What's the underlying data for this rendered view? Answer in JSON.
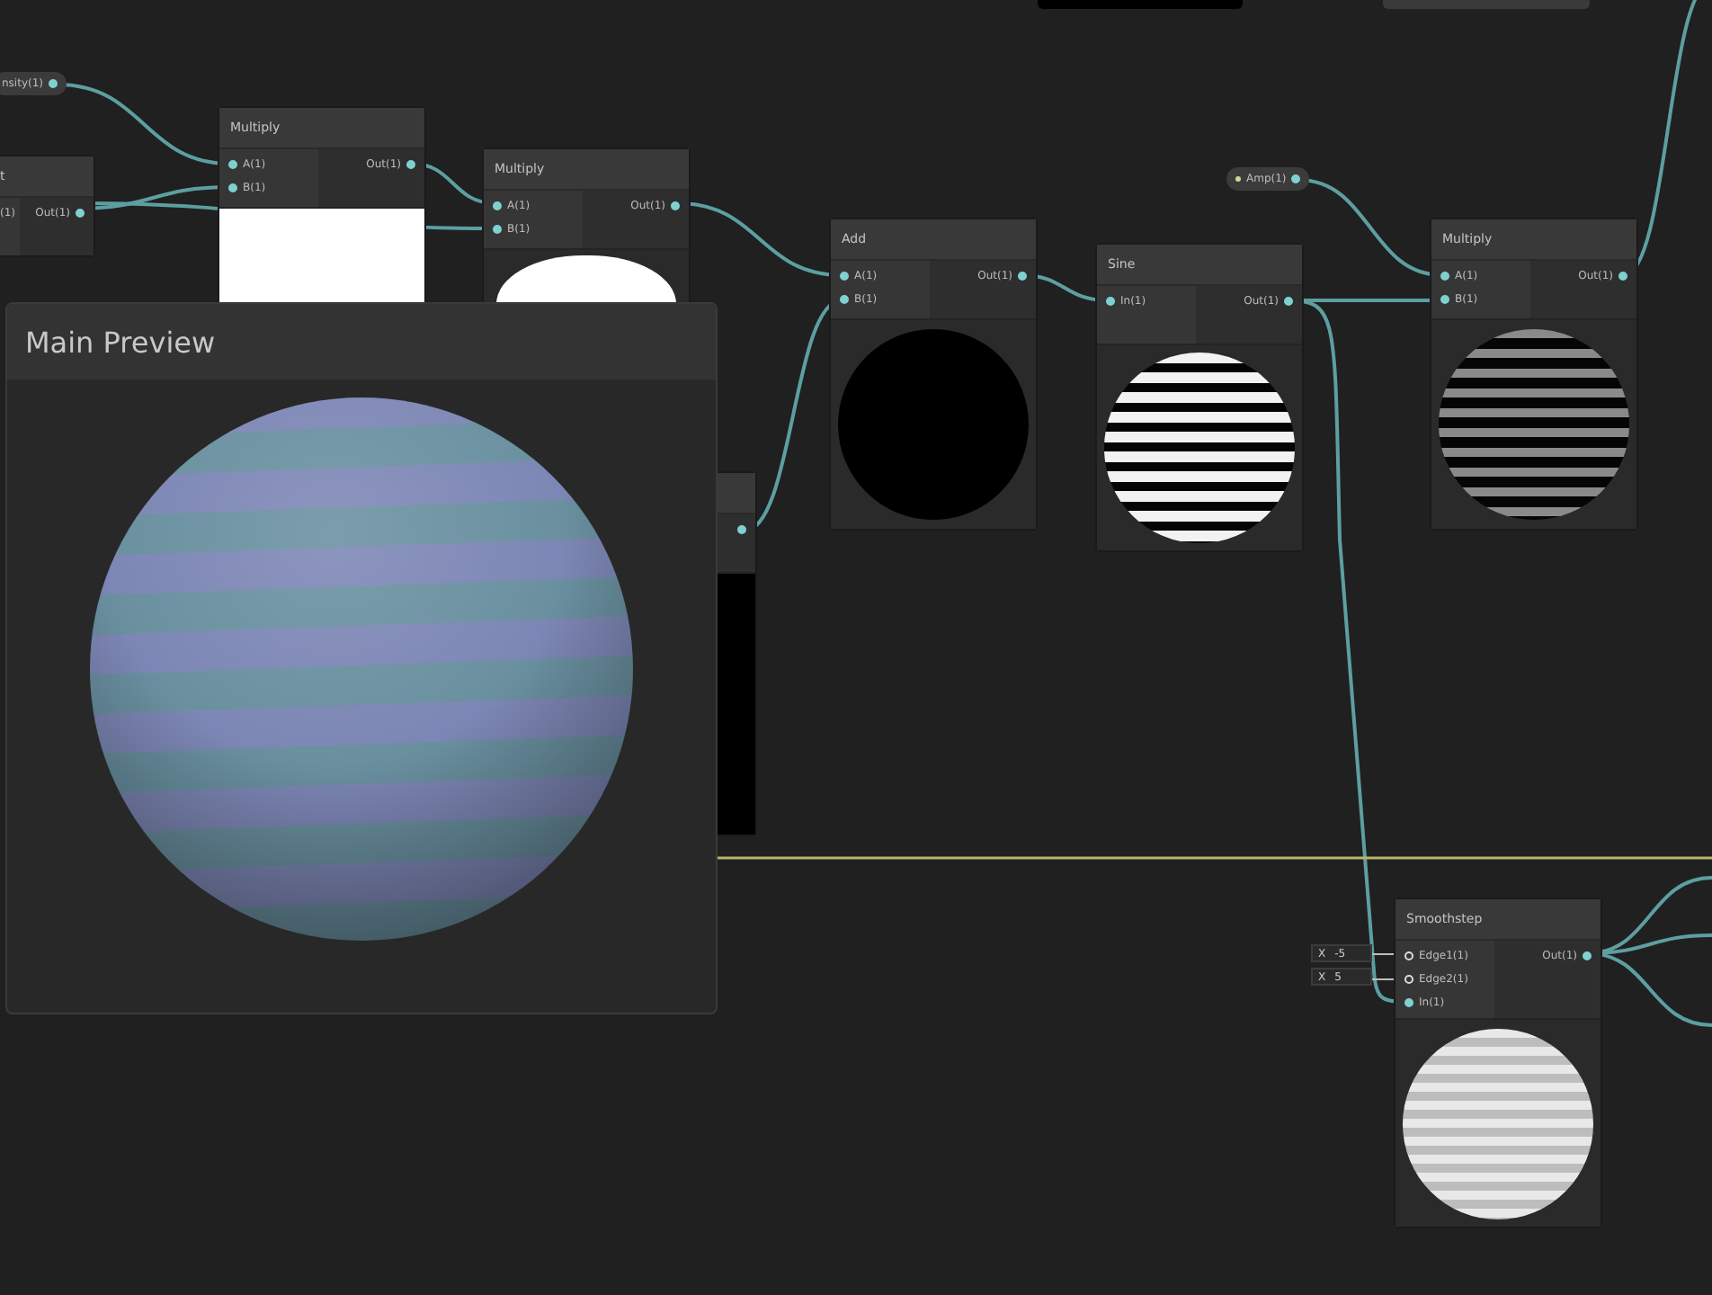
{
  "properties": [
    {
      "label": "nsity(1)"
    },
    {
      "label": "Amp(1)"
    }
  ],
  "nodes": [
    {
      "title": "t",
      "inputs": [
        {
          "label": "(1)"
        }
      ],
      "outputs": [
        {
          "label": "Out(1)",
          "connected": true
        }
      ]
    },
    {
      "title": "Multiply",
      "inputs": [
        {
          "label": "A(1)",
          "connected": true
        },
        {
          "label": "B(1)",
          "connected": true
        }
      ],
      "outputs": [
        {
          "label": "Out(1)",
          "connected": true
        }
      ],
      "kind": "fill-light"
    },
    {
      "title": "Multiply",
      "inputs": [
        {
          "label": "A(1)",
          "connected": true
        },
        {
          "label": "B(1)",
          "connected": true
        }
      ],
      "outputs": [
        {
          "label": "Out(1)",
          "connected": true
        }
      ],
      "kind": "dome"
    },
    {
      "outputs": [
        {
          "connected": true
        }
      ],
      "kind": "fill-dark"
    },
    {
      "title": "Add",
      "inputs": [
        {
          "label": "A(1)",
          "connected": true
        },
        {
          "label": "B(1)",
          "connected": true
        }
      ],
      "outputs": [
        {
          "label": "Out(1)",
          "connected": true
        }
      ],
      "kind": "sphere-dark"
    },
    {
      "title": "Sine",
      "inputs": [
        {
          "label": "In(1)",
          "connected": true
        }
      ],
      "outputs": [
        {
          "label": "Out(1)",
          "connected": true
        }
      ],
      "kind": "stripes"
    },
    {
      "title": "Multiply",
      "inputs": [
        {
          "label": "A(1)",
          "connected": true
        },
        {
          "label": "B(1)",
          "connected": true
        }
      ],
      "outputs": [
        {
          "label": "Out(1)",
          "connected": true
        }
      ],
      "kind": "stripes-dim"
    },
    {
      "title": "Smoothstep",
      "inputs": [
        {
          "label": "Edge1(1)",
          "connected": false,
          "field": {
            "axis": "X",
            "value": "-5"
          }
        },
        {
          "label": "Edge2(1)",
          "connected": false,
          "field": {
            "axis": "X",
            "value": "5"
          }
        },
        {
          "label": "In(1)",
          "connected": true
        }
      ],
      "outputs": [
        {
          "label": "Out(1)",
          "connected": true
        }
      ],
      "kind": "soft-stripes"
    }
  ],
  "main_preview": {
    "title": "Main Preview"
  }
}
